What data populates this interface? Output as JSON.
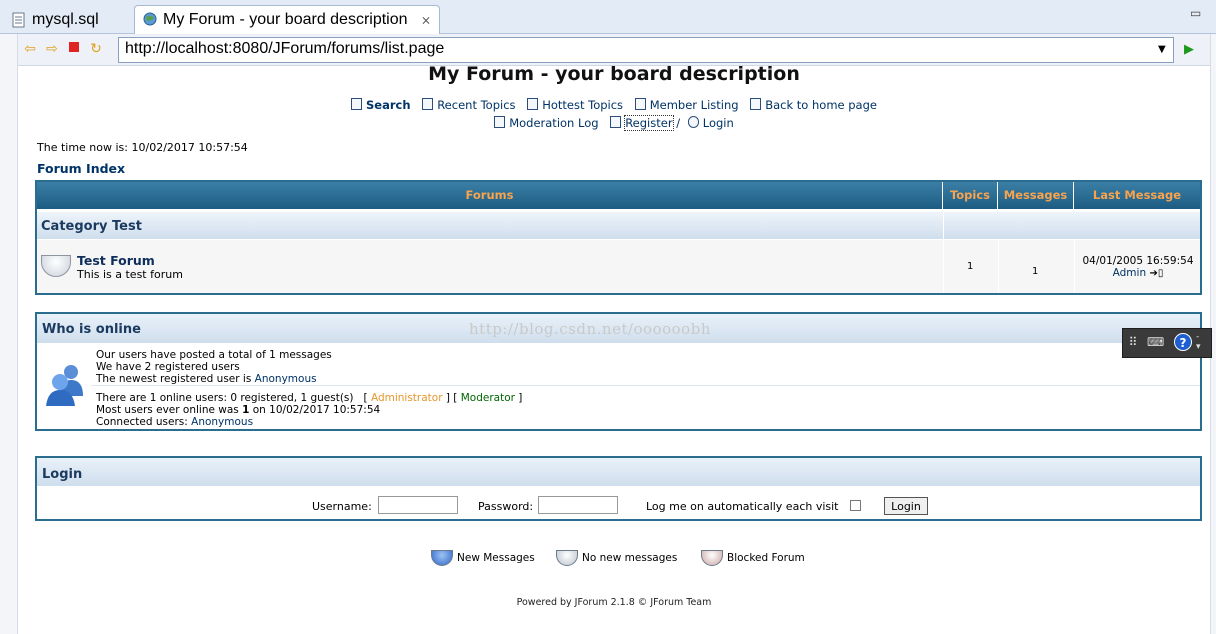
{
  "tabs": [
    {
      "label": "mysql.sql"
    },
    {
      "label": "My Forum - your board description",
      "close": "⨯"
    }
  ],
  "browser": {
    "url": "http://localhost:8080/JForum/forums/list.page"
  },
  "page": {
    "title": "My Forum - your board description",
    "menu": {
      "search": "Search",
      "recent_topics": "Recent Topics",
      "hottest_topics": "Hottest Topics",
      "member_listing": "Member Listing",
      "back_home": "Back to home page",
      "moderation_log": "Moderation Log",
      "register": "Register",
      "register_sep": "/",
      "login": "Login"
    },
    "time_now": "The time now is: 10/02/2017 10:57:54",
    "forum_index": "Forum Index"
  },
  "forum_table": {
    "headers": {
      "forums": "Forums",
      "topics": "Topics",
      "messages": "Messages",
      "last_message": "Last Message"
    },
    "category": "Category Test",
    "forum": {
      "name": "Test Forum",
      "description": "This is a test forum",
      "topics": "1",
      "messages": "1",
      "last_date": "04/01/2005 16:59:54",
      "last_user": "Admin"
    }
  },
  "online": {
    "title": "Who is online",
    "watermark": "http://blog.csdn.net/oooooobh",
    "line1": "Our users have posted a total of 1 messages",
    "line2": "We have 2 registered users",
    "line3_prefix": "The newest registered user is ",
    "line3_user": "Anonymous",
    "line4_prefix": "There are 1 online users: 0 registered, 1 guest(s)",
    "admin_label": "Administrator",
    "mod_label": "Moderator",
    "line5_prefix": "Most users ever online was ",
    "line5_count": "1",
    "line5_suffix": " on 10/02/2017 10:57:54",
    "line6_prefix": "Connected users: ",
    "line6_user": "Anonymous"
  },
  "login": {
    "title": "Login",
    "username_label": "Username:",
    "password_label": "Password:",
    "auto_label": "Log me on automatically each visit",
    "button": "Login"
  },
  "legend": {
    "new": "New Messages",
    "no_new": "No new messages",
    "blocked": "Blocked Forum"
  },
  "footer": "Powered by JForum 2.1.8 © JForum Team"
}
